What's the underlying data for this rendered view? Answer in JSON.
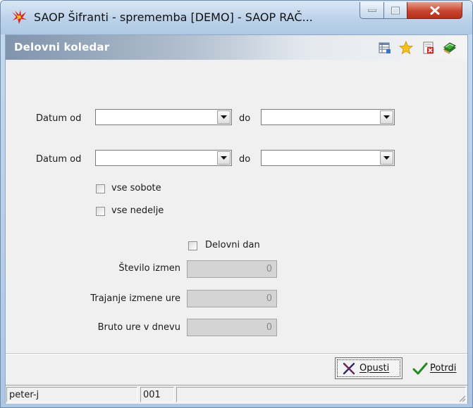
{
  "window": {
    "title": "SAOP  Šifranti  - sprememba [DEMO] - SAOP RAČ..."
  },
  "panel": {
    "title": "Delovni koledar",
    "toolbar_icons": [
      "table-settings-icon",
      "star-icon",
      "delete-document-icon",
      "books-exit-icon"
    ]
  },
  "form": {
    "range1": {
      "from_label": "Datum od",
      "from_value": "",
      "to_label": "do",
      "to_value": ""
    },
    "range2": {
      "from_label": "Datum od",
      "from_value": "",
      "to_label": "do",
      "to_value": ""
    },
    "all_saturdays": {
      "label": "vse sobote",
      "checked": false
    },
    "all_sundays": {
      "label": "vse nedelje",
      "checked": false
    },
    "workday": {
      "label": "Delovni dan",
      "checked": false
    },
    "shift_count": {
      "label": "Število izmen",
      "value": "0"
    },
    "shift_duration": {
      "label": "Trajanje izmene ure",
      "value": "0"
    },
    "gross_hours": {
      "label": "Bruto ure v dnevu",
      "value": "0"
    }
  },
  "buttons": {
    "cancel": "Opusti",
    "confirm": "Potrdi"
  },
  "status": {
    "user": "peter-j",
    "code": "001",
    "extra": ""
  },
  "colors": {
    "panel_header_start": "#8094ac",
    "close_button": "#c8432d",
    "confirm_check": "#1f8a1f",
    "cancel_x": "#2a2a6a"
  }
}
